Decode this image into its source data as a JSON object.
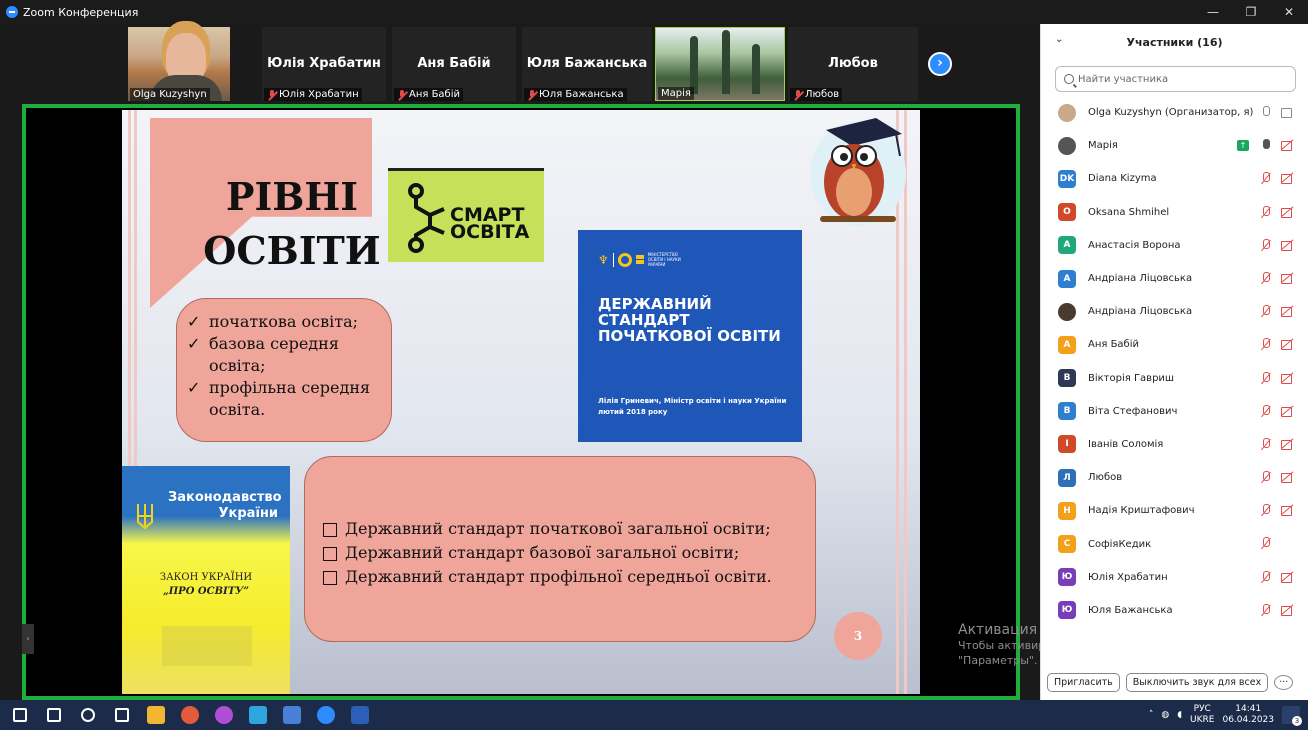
{
  "window": {
    "title": "Zoom Конференция",
    "controls": [
      "—",
      "❐",
      "✕"
    ]
  },
  "gallery": {
    "tiles": [
      {
        "name": "",
        "label": "Olga Kuzyshyn",
        "type": "video",
        "muted": false
      },
      {
        "name": "Юлія Храбатин",
        "label": "Юлія Храбатин",
        "type": "name",
        "muted": true
      },
      {
        "name": "Аня Бабій",
        "label": "Аня Бабій",
        "type": "name",
        "muted": true
      },
      {
        "name": "Юля Бажанська",
        "label": "Юля Бажанська",
        "type": "name",
        "muted": true
      },
      {
        "name": "",
        "label": "Марія",
        "type": "video",
        "muted": false
      },
      {
        "name": "Любов",
        "label": "Любов",
        "type": "name",
        "muted": true
      }
    ],
    "next_glyph": "›"
  },
  "slide": {
    "title_line1": "РІВНІ",
    "title_line2": "ОСВІТИ",
    "smart_logo": "СМАРТ\nОСВІТА",
    "levels": [
      "початкова освіта;",
      "базова середня освіта;",
      "профільна середня освіта."
    ],
    "ministry_small": "МІНІСТЕРСТВО ОСВІТИ І НАУКИ УКРАЇНИ",
    "standard_title": "ДЕРЖАВНИЙ СТАНДАРТ ПОЧАТКОВОЇ ОСВІТИ",
    "standard_author": "Лілія Гриневич, Міністр освіти і науки України",
    "standard_date": "лютий 2018 року",
    "law_header": "Законодавство України",
    "law_title1": "ЗАКОН УКРАЇНИ",
    "law_title2": "„ПРО ОСВІТУ”",
    "standards": [
      "Державний стандарт початкової загальної освіти;",
      "Державний стандарт базової загальної освіти;",
      "Державний стандарт профільної середньої освіти."
    ],
    "page_number": "3"
  },
  "activation": {
    "title": "Активация Windows",
    "line1": "Чтобы активировать Windows, перейдите в раздел",
    "line2": "\"Параметры\"."
  },
  "participants_panel": {
    "title": "Участники (16)",
    "search_placeholder": "Найти участника",
    "participants": [
      {
        "name": "Olga Kuzyshyn (Организатор, я)",
        "initials": "",
        "color": "#c9a98a",
        "photo": true,
        "mic": "on",
        "cam": "on"
      },
      {
        "name": "Марія",
        "initials": "",
        "color": "#555555",
        "photo": true,
        "mic": "dark",
        "cam": "off",
        "sharing": true
      },
      {
        "name": "Diana Kizyma",
        "initials": "DK",
        "color": "#2f7fd0",
        "mic": "off",
        "cam": "off"
      },
      {
        "name": "Oksana Shmihel",
        "initials": "O",
        "color": "#d04a2a",
        "mic": "off",
        "cam": "off"
      },
      {
        "name": "Анастасія Ворона",
        "initials": "А",
        "color": "#21a87a",
        "mic": "off",
        "cam": "off"
      },
      {
        "name": "Андріана Ліцовська",
        "initials": "А",
        "color": "#2f7fd0",
        "mic": "off",
        "cam": "off"
      },
      {
        "name": "Андріана Ліцовська",
        "initials": "",
        "color": "#4a3a30",
        "photo": true,
        "mic": "off",
        "cam": "off"
      },
      {
        "name": "Аня Бабій",
        "initials": "А",
        "color": "#f3a01b",
        "mic": "off",
        "cam": "off"
      },
      {
        "name": "Вікторія Гавриш",
        "initials": "В",
        "color": "#2e3a55",
        "mic": "off",
        "cam": "off"
      },
      {
        "name": "Віта Стефанович",
        "initials": "В",
        "color": "#2f7fd0",
        "mic": "off",
        "cam": "off"
      },
      {
        "name": "Іванів Соломія",
        "initials": "І",
        "color": "#d04a2a",
        "mic": "off",
        "cam": "off"
      },
      {
        "name": "Любов",
        "initials": "Л",
        "color": "#2f6fb8",
        "mic": "off",
        "cam": "off"
      },
      {
        "name": "Надія Криштафович",
        "initials": "Н",
        "color": "#f3a01b",
        "mic": "off",
        "cam": "off"
      },
      {
        "name": "СофіяКедик",
        "initials": "С",
        "color": "#f3a01b",
        "mic": "off",
        "cam": "none"
      },
      {
        "name": "Юлія Храбатин",
        "initials": "Ю",
        "color": "#7a3db8",
        "mic": "off",
        "cam": "off"
      },
      {
        "name": "Юля Бажанська",
        "initials": "Ю",
        "color": "#7a3db8",
        "mic": "off",
        "cam": "off"
      }
    ],
    "invite_label": "Пригласить",
    "mute_all_label": "Выключить звук для всех",
    "more_label": "···"
  },
  "taskbar": {
    "apps": [
      {
        "name": "start",
        "color": "#ffffff"
      },
      {
        "name": "search",
        "color": "#ffffff"
      },
      {
        "name": "cortana",
        "color": "#ffffff"
      },
      {
        "name": "task-view",
        "color": "#ffffff"
      },
      {
        "name": "file-explorer",
        "color": "#f2b632"
      },
      {
        "name": "chrome-profile",
        "color": "#e25b3a"
      },
      {
        "name": "chrome-profile-2",
        "color": "#b04fd6"
      },
      {
        "name": "telegram",
        "color": "#2ea6e0"
      },
      {
        "name": "save",
        "color": "#4a7fd8"
      },
      {
        "name": "zoom",
        "color": "#2d8cff"
      },
      {
        "name": "word",
        "color": "#2b5fb8"
      }
    ],
    "lang_top": "РУС",
    "lang_bottom": "UKRE",
    "time": "14:41",
    "date": "06.04.2023",
    "notifications": "3"
  }
}
